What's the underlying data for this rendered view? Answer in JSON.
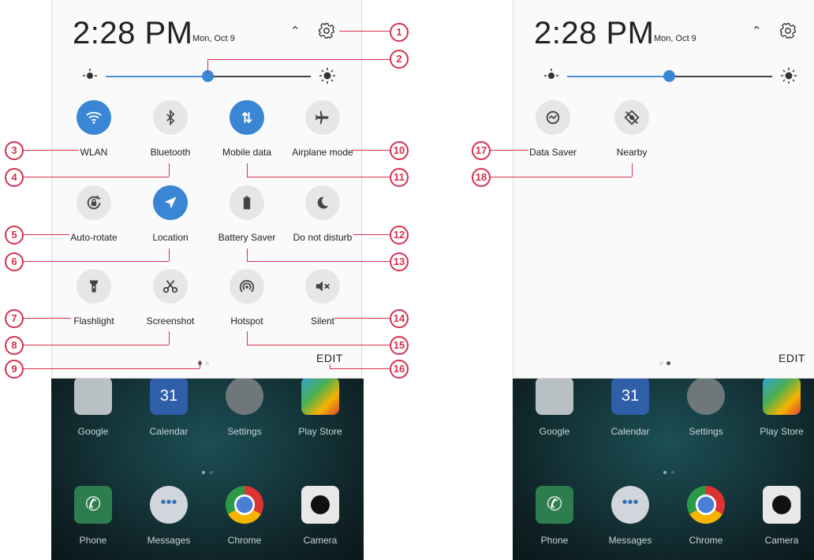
{
  "left_screen": {
    "clock": "2:28 PM",
    "date": "Mon, Oct 9",
    "brightness_level": 0.45,
    "tiles": [
      {
        "label": "WLAN",
        "icon": "wifi-icon",
        "on": true
      },
      {
        "label": "Bluetooth",
        "icon": "bluetooth-icon",
        "on": false
      },
      {
        "label": "Mobile data",
        "icon": "mobile-data-icon",
        "on": true
      },
      {
        "label": "Airplane mode",
        "icon": "airplane-icon",
        "on": false
      },
      {
        "label": "Auto-rotate",
        "icon": "auto-rotate-icon",
        "on": false
      },
      {
        "label": "Location",
        "icon": "location-icon",
        "on": true
      },
      {
        "label": "Battery Saver",
        "icon": "battery-icon",
        "on": false
      },
      {
        "label": "Do not disturb",
        "icon": "moon-icon",
        "on": false
      },
      {
        "label": "Flashlight",
        "icon": "flashlight-icon",
        "on": false
      },
      {
        "label": "Screenshot",
        "icon": "scissors-icon",
        "on": false
      },
      {
        "label": "Hotspot",
        "icon": "hotspot-icon",
        "on": false
      },
      {
        "label": "Silent",
        "icon": "mute-icon",
        "on": false
      }
    ],
    "edit_label": "EDIT",
    "page_indicator": {
      "pages": 2,
      "active": 1
    }
  },
  "right_screen": {
    "clock": "2:28 PM",
    "date": "Mon, Oct 9",
    "brightness_level": 0.45,
    "tiles": [
      {
        "label": "Data Saver",
        "icon": "data-saver-icon",
        "on": false
      },
      {
        "label": "Nearby",
        "icon": "nearby-icon",
        "on": false
      }
    ],
    "edit_label": "EDIT",
    "page_indicator": {
      "pages": 2,
      "active": 2
    }
  },
  "home": {
    "apps_row1": [
      "Google",
      "Calendar",
      "Settings",
      "Play Store"
    ],
    "apps_row2": [
      "Phone",
      "Messages",
      "Chrome",
      "Camera"
    ],
    "calendar_day": "31"
  },
  "callouts": [
    "1",
    "2",
    "3",
    "4",
    "5",
    "6",
    "7",
    "8",
    "9",
    "10",
    "11",
    "12",
    "13",
    "14",
    "15",
    "16",
    "17",
    "18"
  ],
  "colors": {
    "accent": "#3a86d4",
    "annotation": "#d6304c"
  }
}
